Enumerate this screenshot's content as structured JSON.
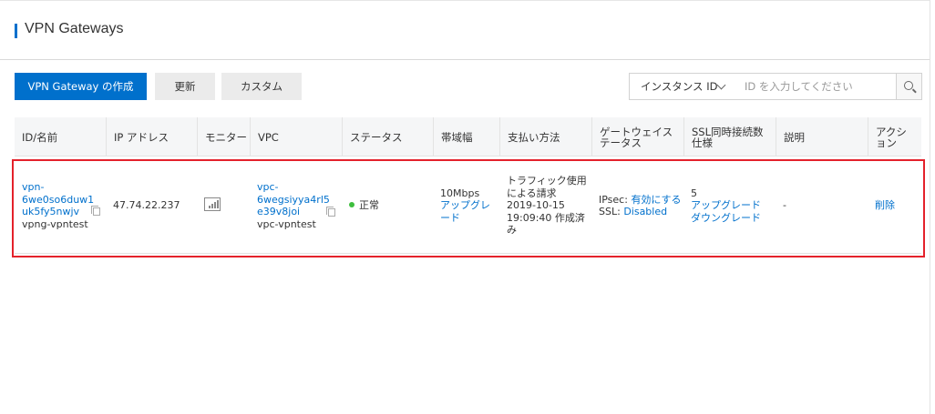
{
  "page": {
    "title": "VPN Gateways"
  },
  "toolbar": {
    "create_label": "VPN Gateway の作成",
    "refresh_label": "更新",
    "custom_label": "カスタム",
    "search_select_value": "インスタンス ID",
    "search_placeholder": "ID を入力してください"
  },
  "table": {
    "headers": [
      "ID/名前",
      "IP アドレス",
      "モニター",
      "VPC",
      "ステータス",
      "帯域幅",
      "支払い方法",
      "ゲートウェイステータス",
      "SSL同時接続数仕様",
      "説明",
      "アクション"
    ],
    "rows": [
      {
        "id_lines": [
          "vpn-",
          "6we0so6duw1",
          "uk5fy5nwjv"
        ],
        "name": "vpng-vpntest",
        "ip": "47.74.22.237",
        "vpc_id_lines": [
          "vpc-",
          "6wegsiyya4rl5",
          "e39v8joi"
        ],
        "vpc_name": "vpc-vpntest",
        "status": "正常",
        "bandwidth": "10Mbps",
        "bandwidth_action": "アップグレード",
        "payment_lines": [
          "トラフィック使用",
          "による請求",
          "2019-10-15",
          "19:09:40 作成済",
          "み"
        ],
        "gw_ipsec_label": "IPsec:",
        "gw_ipsec_value": "有効にする",
        "gw_ssl_label": "SSL:",
        "gw_ssl_value": "Disabled",
        "ssl_count": "5",
        "ssl_upgrade": "アップグレード",
        "ssl_downgrade": "ダウングレード",
        "description": "-",
        "action_delete": "削除"
      }
    ]
  },
  "colors": {
    "primary": "#0070cc",
    "highlight_border": "#e4222b",
    "status_ok": "#3ebe3e"
  },
  "icons": {
    "copy": "copy-icon",
    "monitor": "bar-chart-icon",
    "search": "search-icon",
    "chevron": "chevron-down-icon"
  }
}
